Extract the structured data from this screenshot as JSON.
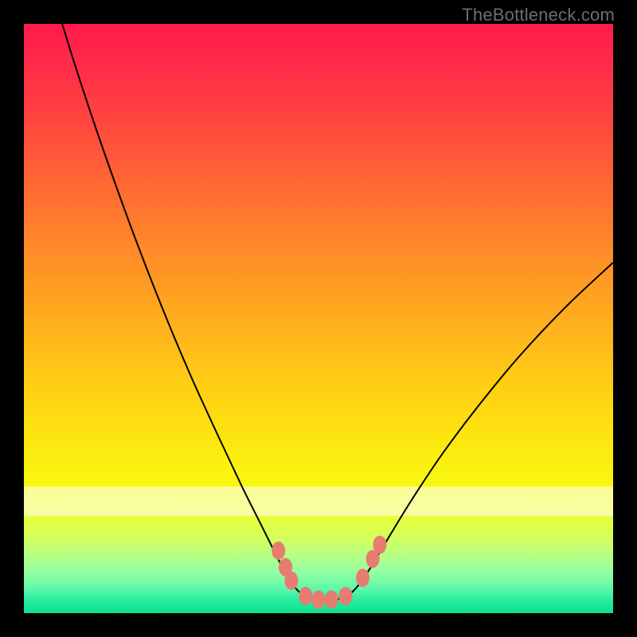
{
  "watermark": "TheBottleneck.com",
  "chart_data": {
    "type": "line",
    "title": "",
    "xlabel": "",
    "ylabel": "",
    "xlim": [
      0,
      100
    ],
    "ylim": [
      0,
      100
    ],
    "grid": false,
    "legend": false,
    "curve": [
      {
        "x": 6.5,
        "y": 100.0
      },
      {
        "x": 9.0,
        "y": 92.0
      },
      {
        "x": 13.0,
        "y": 80.0
      },
      {
        "x": 18.0,
        "y": 66.0
      },
      {
        "x": 23.0,
        "y": 53.0
      },
      {
        "x": 28.0,
        "y": 41.0
      },
      {
        "x": 33.0,
        "y": 30.0
      },
      {
        "x": 37.0,
        "y": 21.5
      },
      {
        "x": 40.0,
        "y": 15.5
      },
      {
        "x": 42.0,
        "y": 11.5
      },
      {
        "x": 43.5,
        "y": 8.5
      },
      {
        "x": 45.5,
        "y": 5.0
      },
      {
        "x": 47.5,
        "y": 3.0
      },
      {
        "x": 50.0,
        "y": 2.2
      },
      {
        "x": 52.5,
        "y": 2.2
      },
      {
        "x": 55.0,
        "y": 3.0
      },
      {
        "x": 57.0,
        "y": 5.0
      },
      {
        "x": 59.0,
        "y": 8.0
      },
      {
        "x": 62.0,
        "y": 13.0
      },
      {
        "x": 66.0,
        "y": 19.5
      },
      {
        "x": 71.0,
        "y": 27.0
      },
      {
        "x": 77.0,
        "y": 35.0
      },
      {
        "x": 84.0,
        "y": 43.5
      },
      {
        "x": 92.0,
        "y": 52.0
      },
      {
        "x": 100.0,
        "y": 59.5
      }
    ],
    "markers": [
      {
        "x": 43.2,
        "y": 10.6
      },
      {
        "x": 44.4,
        "y": 7.8
      },
      {
        "x": 45.4,
        "y": 5.5
      },
      {
        "x": 47.8,
        "y": 2.9
      },
      {
        "x": 50.0,
        "y": 2.3
      },
      {
        "x": 52.2,
        "y": 2.3
      },
      {
        "x": 54.6,
        "y": 2.9
      },
      {
        "x": 57.5,
        "y": 6.0
      },
      {
        "x": 59.2,
        "y": 9.2
      },
      {
        "x": 60.4,
        "y": 11.6
      }
    ],
    "marker_color": "#e77c70",
    "curve_color": "#000000"
  }
}
